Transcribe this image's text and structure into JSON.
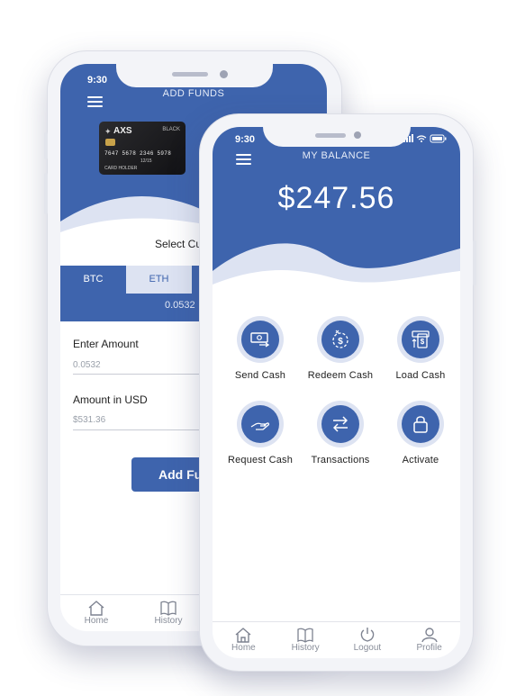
{
  "colors": {
    "primary": "#3e64ad",
    "wave": "#dde3f2"
  },
  "back_phone": {
    "status_time": "9:30",
    "title": "ADD FUNDS",
    "card": {
      "brand": "AXS",
      "tier": "BLACK",
      "number": "7647 5678 2346 5978",
      "expiry": "12/15",
      "holder": "CARD HOLDER"
    },
    "select_label": "Select Cu",
    "tabs": [
      "BTC",
      "ETH"
    ],
    "crypto_value": "0.0532",
    "enter_amount_label": "Enter Amount",
    "enter_amount_value": "0.0532",
    "amount_usd_label": "Amount in USD",
    "amount_usd_value": "$531.36",
    "add_button": "Add Fu",
    "nav": [
      "Home",
      "History"
    ]
  },
  "front_phone": {
    "status_time": "9:30",
    "title": "MY BALANCE",
    "balance": "$247.56",
    "actions": [
      {
        "label": "Send Cash",
        "icon": "cash-send-icon"
      },
      {
        "label": "Redeem Cash",
        "icon": "redeem-icon"
      },
      {
        "label": "Load Cash",
        "icon": "atm-icon"
      },
      {
        "label": "Request Cash",
        "icon": "hand-icon"
      },
      {
        "label": "Transactions",
        "icon": "exchange-arrows-icon"
      },
      {
        "label": "Activate",
        "icon": "lock-icon"
      }
    ],
    "nav": [
      "Home",
      "History",
      "Logout",
      "Profile"
    ]
  }
}
